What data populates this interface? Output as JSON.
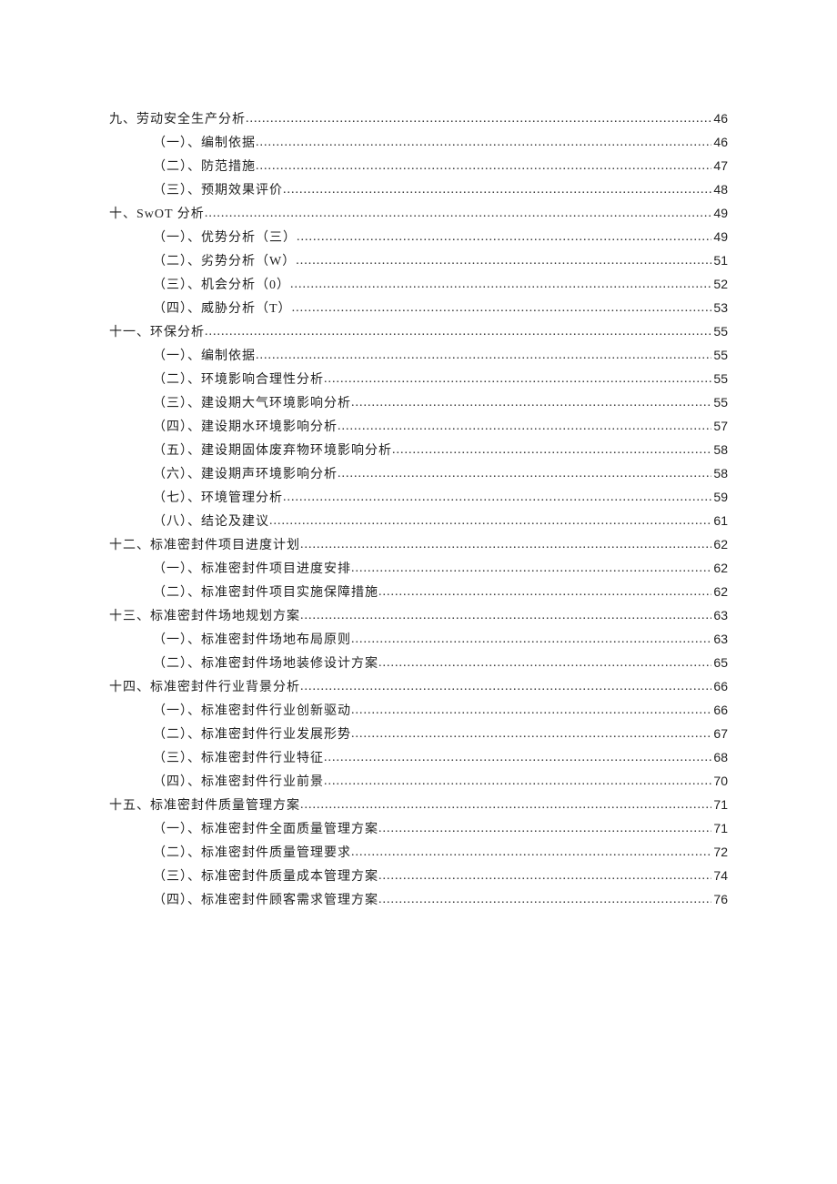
{
  "toc": [
    {
      "level": 1,
      "label": "九、劳动安全生产分析",
      "page": "46"
    },
    {
      "level": 2,
      "label": "（一）、编制依据",
      "page": "46"
    },
    {
      "level": 2,
      "label": "（二）、防范措施",
      "page": "47"
    },
    {
      "level": 2,
      "label": "（三）、预期效果评价",
      "page": "48"
    },
    {
      "level": 1,
      "label": "十、SwOT 分析",
      "page": "49"
    },
    {
      "level": 2,
      "label": "（一）、优势分析（三）",
      "page": "49"
    },
    {
      "level": 2,
      "label": "（二）、劣势分析（W）",
      "page": "51"
    },
    {
      "level": 2,
      "label": "（三）、机会分析（0）",
      "page": "52"
    },
    {
      "level": 2,
      "label": "（四）、威胁分析（T）",
      "page": "53"
    },
    {
      "level": 1,
      "label": "十一、环保分析",
      "page": "55"
    },
    {
      "level": 2,
      "label": "（一）、编制依据",
      "page": "55"
    },
    {
      "level": 2,
      "label": "（二）、环境影响合理性分析",
      "page": "55"
    },
    {
      "level": 2,
      "label": "（三）、建设期大气环境影响分析",
      "page": "55"
    },
    {
      "level": 2,
      "label": "（四）、建设期水环境影响分析",
      "page": "57"
    },
    {
      "level": 2,
      "label": "（五）、建设期固体废弃物环境影响分析",
      "page": "58"
    },
    {
      "level": 2,
      "label": "（六）、建设期声环境影响分析",
      "page": "58"
    },
    {
      "level": 2,
      "label": "（七）、环境管理分析",
      "page": "59"
    },
    {
      "level": 2,
      "label": "（八）、结论及建议",
      "page": "61"
    },
    {
      "level": 1,
      "label": "十二、标准密封件项目进度计划",
      "page": "62"
    },
    {
      "level": 2,
      "label": "（一）、标准密封件项目进度安排",
      "page": "62"
    },
    {
      "level": 2,
      "label": "（二）、标准密封件项目实施保障措施",
      "page": "62"
    },
    {
      "level": 1,
      "label": "十三、标准密封件场地规划方案",
      "page": "63"
    },
    {
      "level": 2,
      "label": "（一）、标准密封件场地布局原则",
      "page": "63"
    },
    {
      "level": 2,
      "label": "（二）、标准密封件场地装修设计方案",
      "page": "65"
    },
    {
      "level": 1,
      "label": "十四、标准密封件行业背景分析",
      "page": "66"
    },
    {
      "level": 2,
      "label": "（一）、标准密封件行业创新驱动",
      "page": "66"
    },
    {
      "level": 2,
      "label": "（二）、标准密封件行业发展形势",
      "page": "67"
    },
    {
      "level": 2,
      "label": "（三）、标准密封件行业特征",
      "page": "68"
    },
    {
      "level": 2,
      "label": "（四）、标准密封件行业前景",
      "page": "70"
    },
    {
      "level": 1,
      "label": "十五、标准密封件质量管理方案",
      "page": "71"
    },
    {
      "level": 2,
      "label": "（一）、标准密封件全面质量管理方案",
      "page": "71"
    },
    {
      "level": 2,
      "label": "（二）、标准密封件质量管理要求",
      "page": "72"
    },
    {
      "level": 2,
      "label": "（三）、标准密封件质量成本管理方案",
      "page": "74"
    },
    {
      "level": 2,
      "label": "（四）、标准密封件顾客需求管理方案",
      "page": "76"
    }
  ]
}
